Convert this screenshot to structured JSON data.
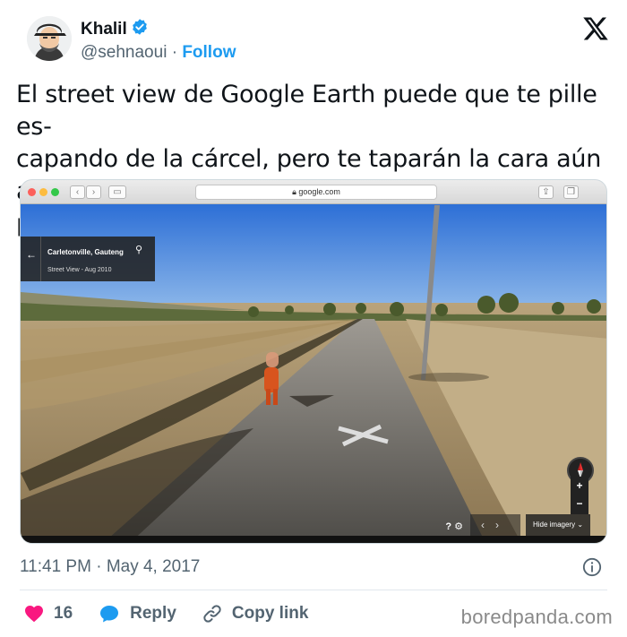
{
  "author": {
    "name": "Khalil",
    "handle": "@sehnaoui",
    "separator": "·",
    "follow_label": "Follow",
    "verified_icon": "verified-badge-icon",
    "brand_color": "#1d9bf0"
  },
  "tweet": {
    "text": "El street view de Google Earth puede que te pille es-\ncapando de la cárcel, pero te taparán la cara aún así\nporque en google no son unos soplones."
  },
  "media": {
    "browser": {
      "url": "google.com"
    },
    "street_view": {
      "place": "Carletonville, Gauteng",
      "date": "Street View - Aug 2010",
      "hide_imagery_label": "Hide imagery",
      "zoom_in": "+",
      "zoom_out": "−"
    }
  },
  "timestamp": {
    "time": "11:41 PM",
    "separator": "·",
    "date": "May 4, 2017"
  },
  "actions": {
    "like_count": "16",
    "reply_label": "Reply",
    "copy_link_label": "Copy link",
    "like_color": "#f91880"
  },
  "watermark": "boredpanda.com"
}
